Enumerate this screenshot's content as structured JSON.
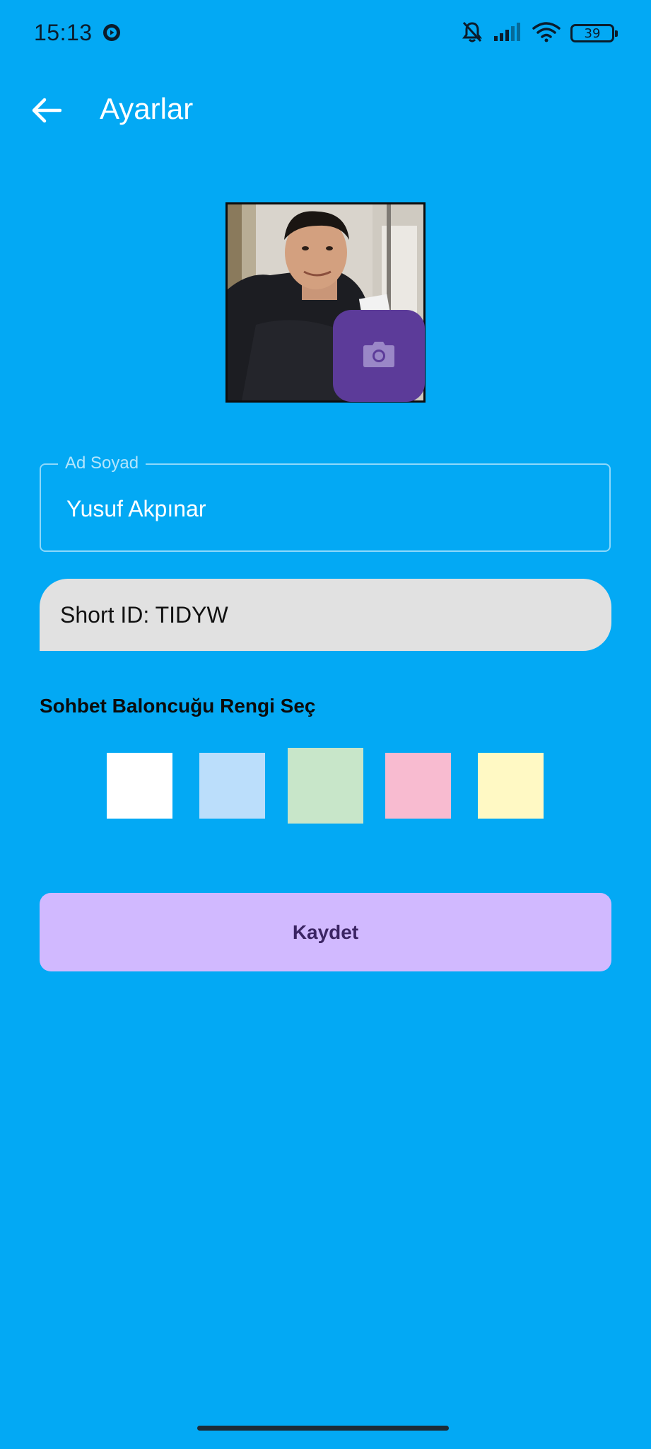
{
  "status_bar": {
    "time": "15:13",
    "battery": "39",
    "icons": [
      "media-playing-icon",
      "muted-bell-icon",
      "signal-icon",
      "wifi-icon",
      "battery-icon"
    ]
  },
  "app_bar": {
    "title": "Ayarlar",
    "back_icon": "arrow-left-icon"
  },
  "profile": {
    "photo_alt": "Profile photo",
    "camera_icon": "camera-icon"
  },
  "form": {
    "name_label": "Ad Soyad",
    "name_value": "Yusuf Akpınar",
    "short_id": "Short ID: TIDYW"
  },
  "bubble_color": {
    "title": "Sohbet Baloncuğu Rengi Seç",
    "options": [
      "#FFFFFF",
      "#BBDEFB",
      "#C8E6C9",
      "#F8BBD0",
      "#FFF9C4"
    ],
    "selected_index": 2
  },
  "actions": {
    "save_label": "Kaydet"
  },
  "colors": {
    "background": "#03A9F4",
    "camera_button": "#5C3B99",
    "save_button": "#D1B9FF",
    "short_id_bg": "#E1E1E1"
  }
}
